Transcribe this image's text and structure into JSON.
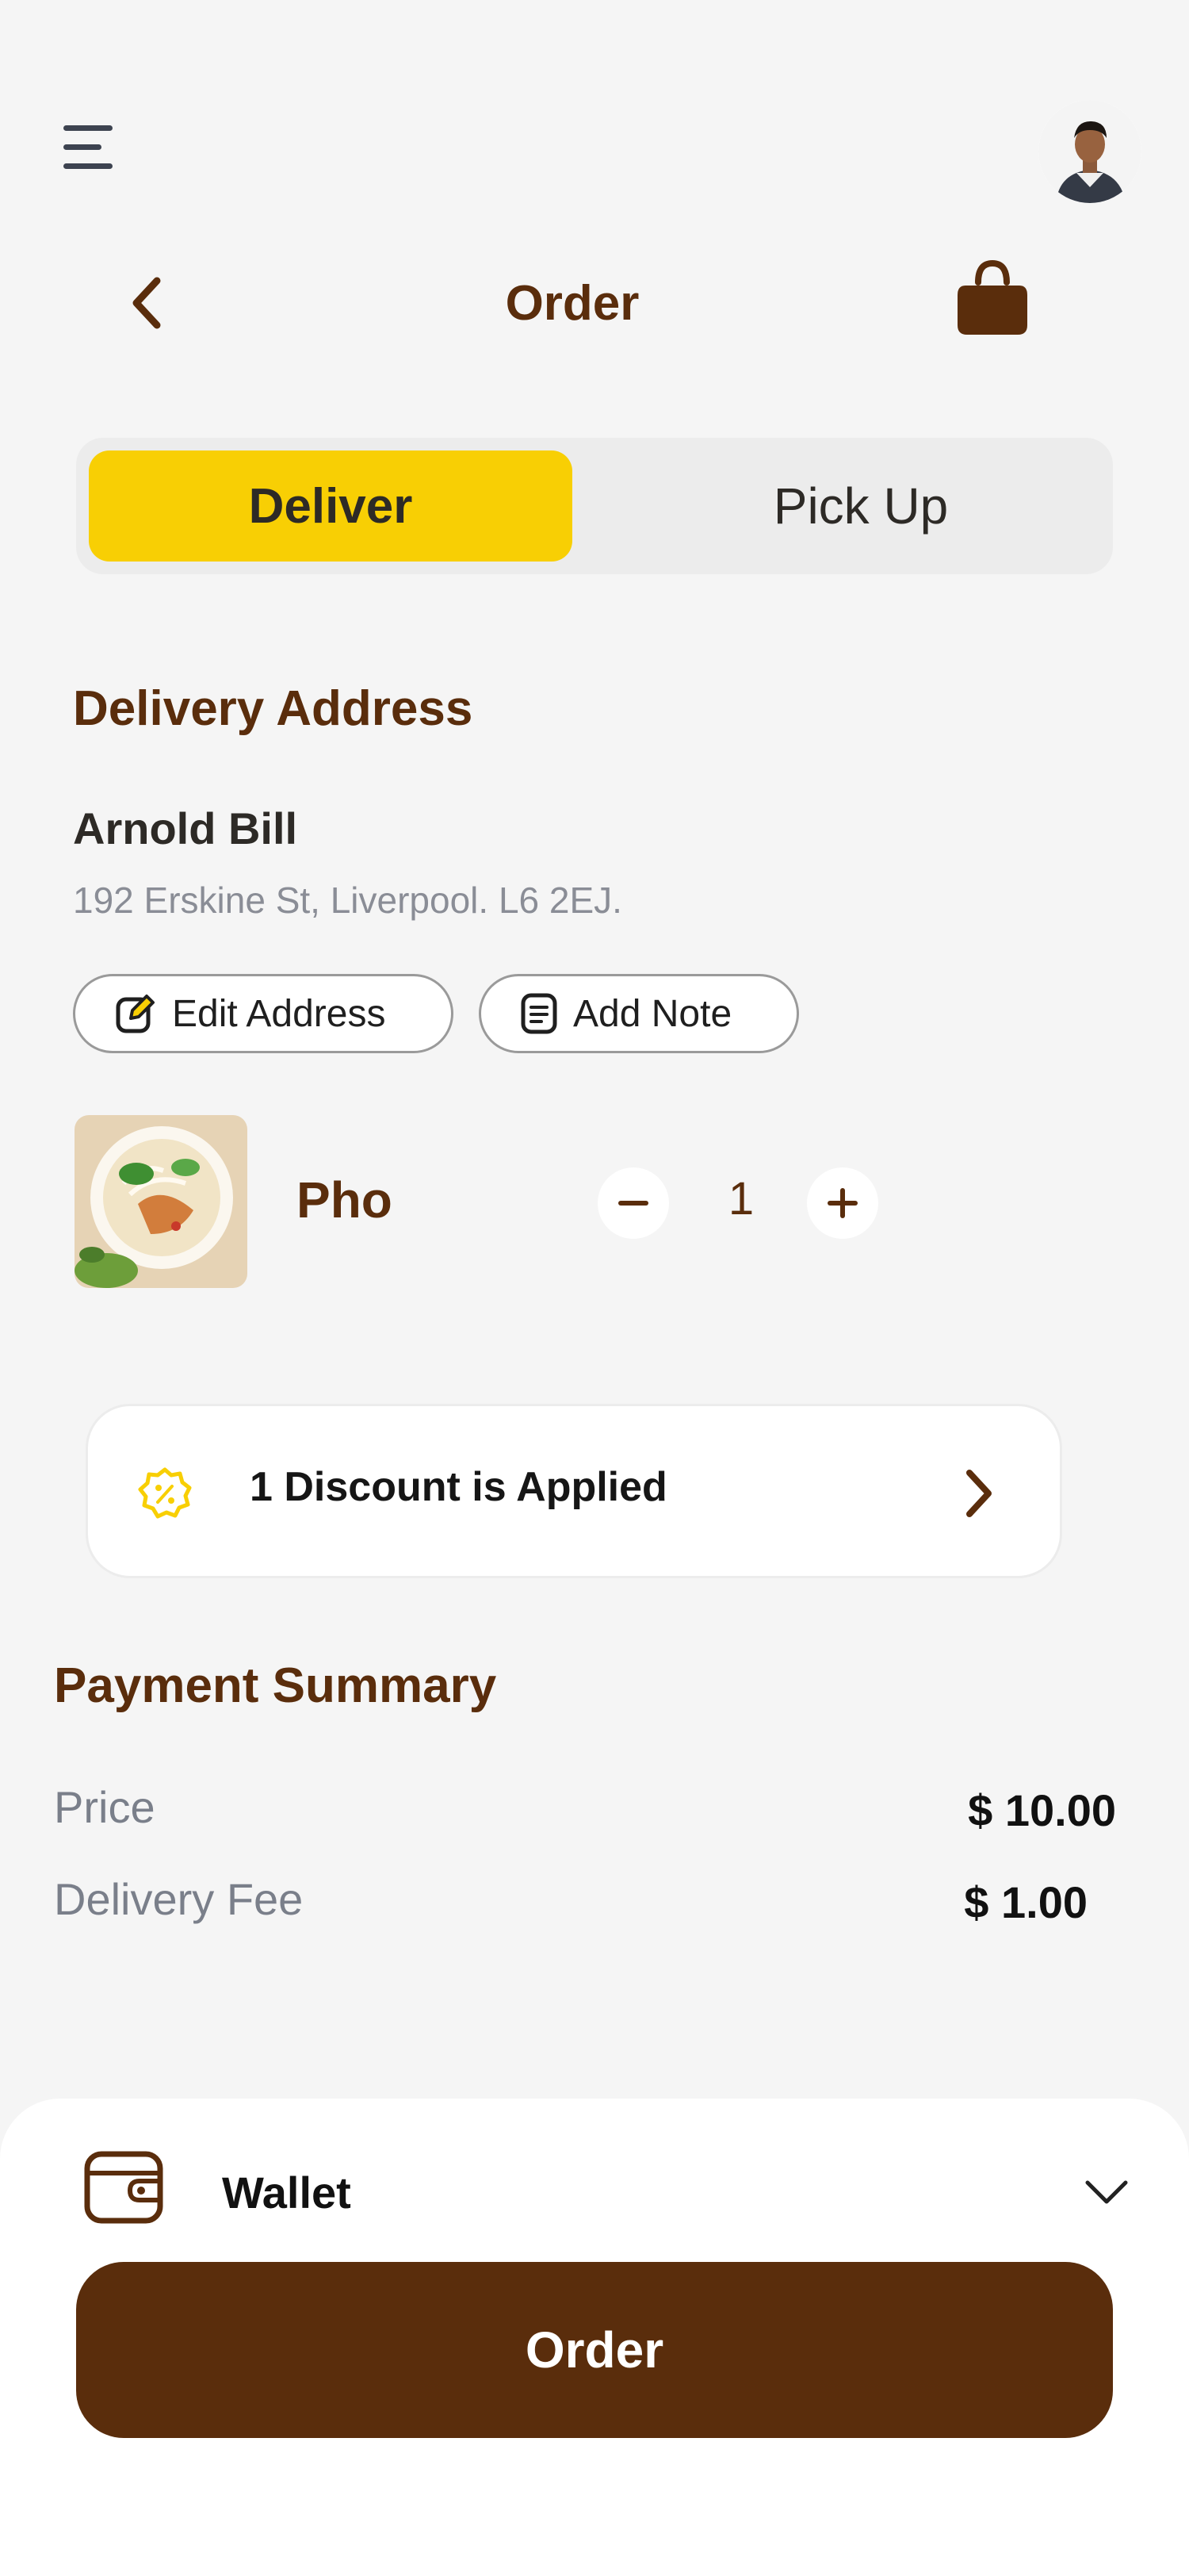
{
  "header": {
    "title": "Order"
  },
  "icons": {
    "menu": "menu-icon",
    "avatar": "avatar",
    "back": "chevron-left-icon",
    "bag": "shopping-bag-icon",
    "edit": "edit-icon",
    "note": "note-icon",
    "discount": "discount-badge-icon",
    "chevron_right": "chevron-right-icon",
    "wallet": "wallet-icon",
    "chevron_down": "chevron-down-icon"
  },
  "segmented": {
    "active_label": "Deliver",
    "inactive_label": "Pick Up"
  },
  "delivery": {
    "section_title": "Delivery Address",
    "name": "Arnold Bill",
    "address": "192 Erskine St, Liverpool. L6 2EJ.",
    "edit_label": "Edit Address",
    "note_label": "Add Note"
  },
  "item": {
    "name": "Pho",
    "quantity": "1"
  },
  "discount": {
    "text": "1 Discount is Applied"
  },
  "payment": {
    "title": "Payment Summary",
    "rows": [
      {
        "label": "Price",
        "value": "$ 10.00"
      },
      {
        "label": "Delivery Fee",
        "value": "$ 1.00"
      }
    ]
  },
  "checkout": {
    "payment_method": "Wallet",
    "order_label": "Order"
  },
  "colors": {
    "brand_brown": "#5a2d0c",
    "accent_yellow": "#f8cf04",
    "background": "#f5f5f5"
  }
}
